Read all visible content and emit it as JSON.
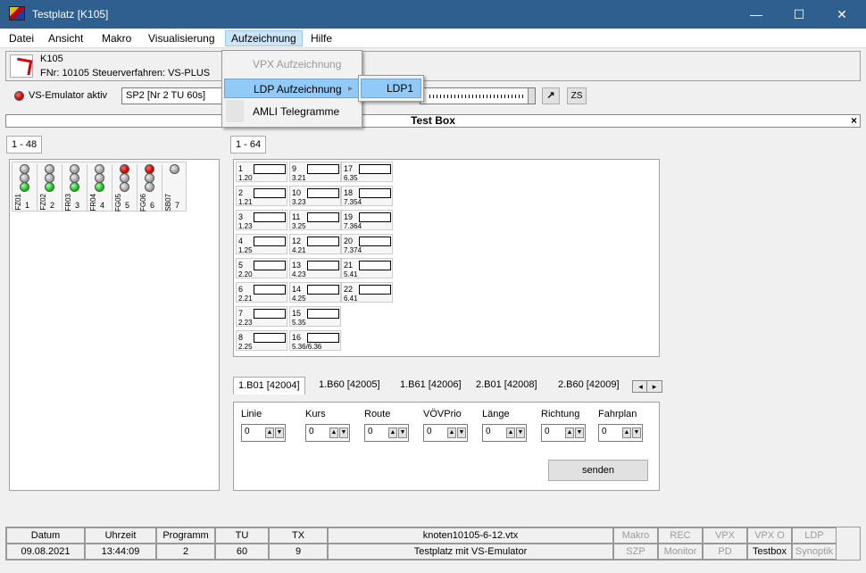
{
  "window": {
    "title": "Testplatz [K105]",
    "minimize": "—",
    "maximize": "☐",
    "close": "✕"
  },
  "menu": [
    "Datei",
    "Ansicht",
    "Makro",
    "Visualisierung",
    "Aufzeichnung",
    "Hilfe"
  ],
  "menu_aufzeichnung": {
    "items": [
      {
        "label": "VPX Aufzeichnung",
        "disabled": true
      },
      {
        "label": "LDP Aufzeichnung",
        "highlighted": true,
        "submenu_arrow": "▸"
      },
      {
        "label": "AMLI Telegramme"
      }
    ],
    "submenu_ldp": [
      "LDP1"
    ]
  },
  "info": {
    "name": "K105",
    "details": "FNr: 10105  Steuerverfahren: VS-PLUS"
  },
  "toolbar": {
    "emulator_label": "VS-Emulator aktiv",
    "program": "SP2 [Nr 2 TU 60s]",
    "zs_label": "ZS",
    "arrow_icon": "↗"
  },
  "testbox": {
    "title": "Test Box",
    "close": "×"
  },
  "signal_tab": "1 - 48",
  "signal_groups": [
    {
      "name": "FZ01",
      "num": "1",
      "lamps": [
        "grey",
        "grey",
        "green"
      ]
    },
    {
      "name": "FZ02",
      "num": "2",
      "lamps": [
        "grey",
        "grey",
        "green"
      ]
    },
    {
      "name": "FR03",
      "num": "3",
      "lamps": [
        "grey",
        "grey",
        "green"
      ]
    },
    {
      "name": "FR04",
      "num": "4",
      "lamps": [
        "grey",
        "grey",
        "green"
      ]
    },
    {
      "name": "FG05",
      "num": "5",
      "lamps": [
        "red",
        "grey",
        "grey"
      ]
    },
    {
      "name": "FG06",
      "num": "6",
      "lamps": [
        "red",
        "grey",
        "grey"
      ]
    },
    {
      "name": "SB07",
      "num": "7",
      "lamps": [
        "grey"
      ]
    }
  ],
  "detector_tab": "1 - 64",
  "detectors": [
    {
      "num": "1",
      "sub": "1.20"
    },
    {
      "num": "2",
      "sub": "1.21"
    },
    {
      "num": "3",
      "sub": "1.23"
    },
    {
      "num": "4",
      "sub": "1.25"
    },
    {
      "num": "5",
      "sub": "2.20"
    },
    {
      "num": "6",
      "sub": "2.21"
    },
    {
      "num": "7",
      "sub": "2.23"
    },
    {
      "num": "8",
      "sub": "2.25"
    },
    {
      "num": "9",
      "sub": "3.21"
    },
    {
      "num": "10",
      "sub": "3.23"
    },
    {
      "num": "11",
      "sub": "3.25"
    },
    {
      "num": "12",
      "sub": "4.21"
    },
    {
      "num": "13",
      "sub": "4.23"
    },
    {
      "num": "14",
      "sub": "4.25"
    },
    {
      "num": "15",
      "sub": "5.35"
    },
    {
      "num": "16",
      "sub": "5.36/6.36"
    },
    {
      "num": "17",
      "sub": "6.35"
    },
    {
      "num": "18",
      "sub": "7.354"
    },
    {
      "num": "19",
      "sub": "7.364"
    },
    {
      "num": "20",
      "sub": "7.374"
    },
    {
      "num": "21",
      "sub": "5.41"
    },
    {
      "num": "22",
      "sub": "6.41"
    }
  ],
  "vehicle_tabs": [
    "1.B01 [42004]",
    "1.B60 [42005]",
    "1.B61 [42006]",
    "2.B01 [42008]",
    "2.B60 [42009]"
  ],
  "tab_scroll": {
    "left": "◂",
    "right": "▸"
  },
  "vehicle_fields": [
    {
      "label": "Linie",
      "value": "0"
    },
    {
      "label": "Kurs",
      "value": "0"
    },
    {
      "label": "Route",
      "value": "0"
    },
    {
      "label": "VÖVPrio",
      "value": "0"
    },
    {
      "label": "Länge",
      "value": "0"
    },
    {
      "label": "Richtung",
      "value": "0"
    },
    {
      "label": "Fahrplan",
      "value": "0"
    }
  ],
  "spin_up": "▲",
  "spin_down": "▼",
  "send_label": "senden",
  "status": {
    "headers": [
      "Datum",
      "Uhrzeit",
      "Programm",
      "TU",
      "TX",
      "knoten10105-6-12.vtx"
    ],
    "values": [
      "09.08.2021",
      "13:44:09",
      "2",
      "60",
      "9",
      "Testplatz mit VS-Emulator"
    ],
    "right_top": [
      {
        "label": "Makro",
        "disabled": true
      },
      {
        "label": "REC",
        "disabled": true
      },
      {
        "label": "VPX",
        "disabled": true
      },
      {
        "label": "VPX O",
        "disabled": true
      },
      {
        "label": "LDP",
        "disabled": true
      }
    ],
    "right_bottom": [
      {
        "label": "SZP",
        "disabled": true
      },
      {
        "label": "Monitor",
        "disabled": true
      },
      {
        "label": "PD",
        "disabled": true
      },
      {
        "label": "Testbox",
        "disabled": false
      },
      {
        "label": "Synoptik",
        "disabled": true
      }
    ]
  }
}
